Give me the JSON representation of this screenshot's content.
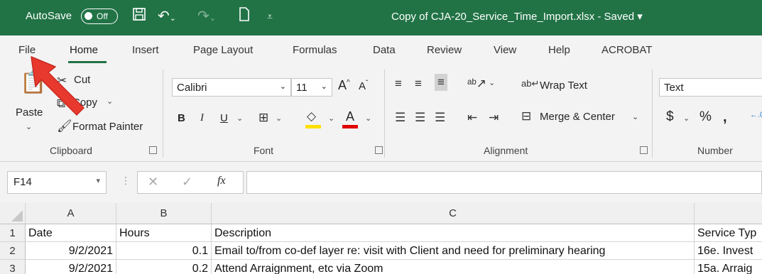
{
  "titlebar": {
    "autosave_label": "AutoSave",
    "autosave_state": "Off",
    "file_title": "Copy of CJA-20_Service_Time_Import.xlsx  -  Saved  ▾",
    "accent": "#217346"
  },
  "tabs": [
    "File",
    "Home",
    "Insert",
    "Page Layout",
    "Formulas",
    "Data",
    "Review",
    "View",
    "Help",
    "ACROBAT"
  ],
  "ribbon": {
    "clipboard": {
      "paste": "Paste",
      "cut": "Cut",
      "copy": "Copy",
      "format_painter": "Format Painter",
      "label": "Clipboard"
    },
    "font": {
      "name": "Calibri",
      "size": "11",
      "label": "Font"
    },
    "alignment": {
      "wrap_text": "Wrap Text",
      "merge_center": "Merge & Center",
      "label": "Alignment"
    },
    "number": {
      "format": "Text",
      "label": "Number"
    }
  },
  "formula_bar": {
    "name_box": "F14",
    "formula": ""
  },
  "grid": {
    "columns": [
      "A",
      "B",
      "C"
    ],
    "rows": [
      {
        "num": "1",
        "date": "Date",
        "hours": "Hours",
        "desc": "Description",
        "service": "Service Typ"
      },
      {
        "num": "2",
        "date": "9/2/2021",
        "hours": "0.1",
        "desc": "Email to/from co-def layer  re: visit with Client and need for preliminary hearing",
        "service": "16e. Invest"
      },
      {
        "num": "3",
        "date": "9/2/2021",
        "hours": "0.2",
        "desc": "Attend Arraignment, etc via Zoom",
        "service": "15a. Arraig"
      }
    ]
  }
}
